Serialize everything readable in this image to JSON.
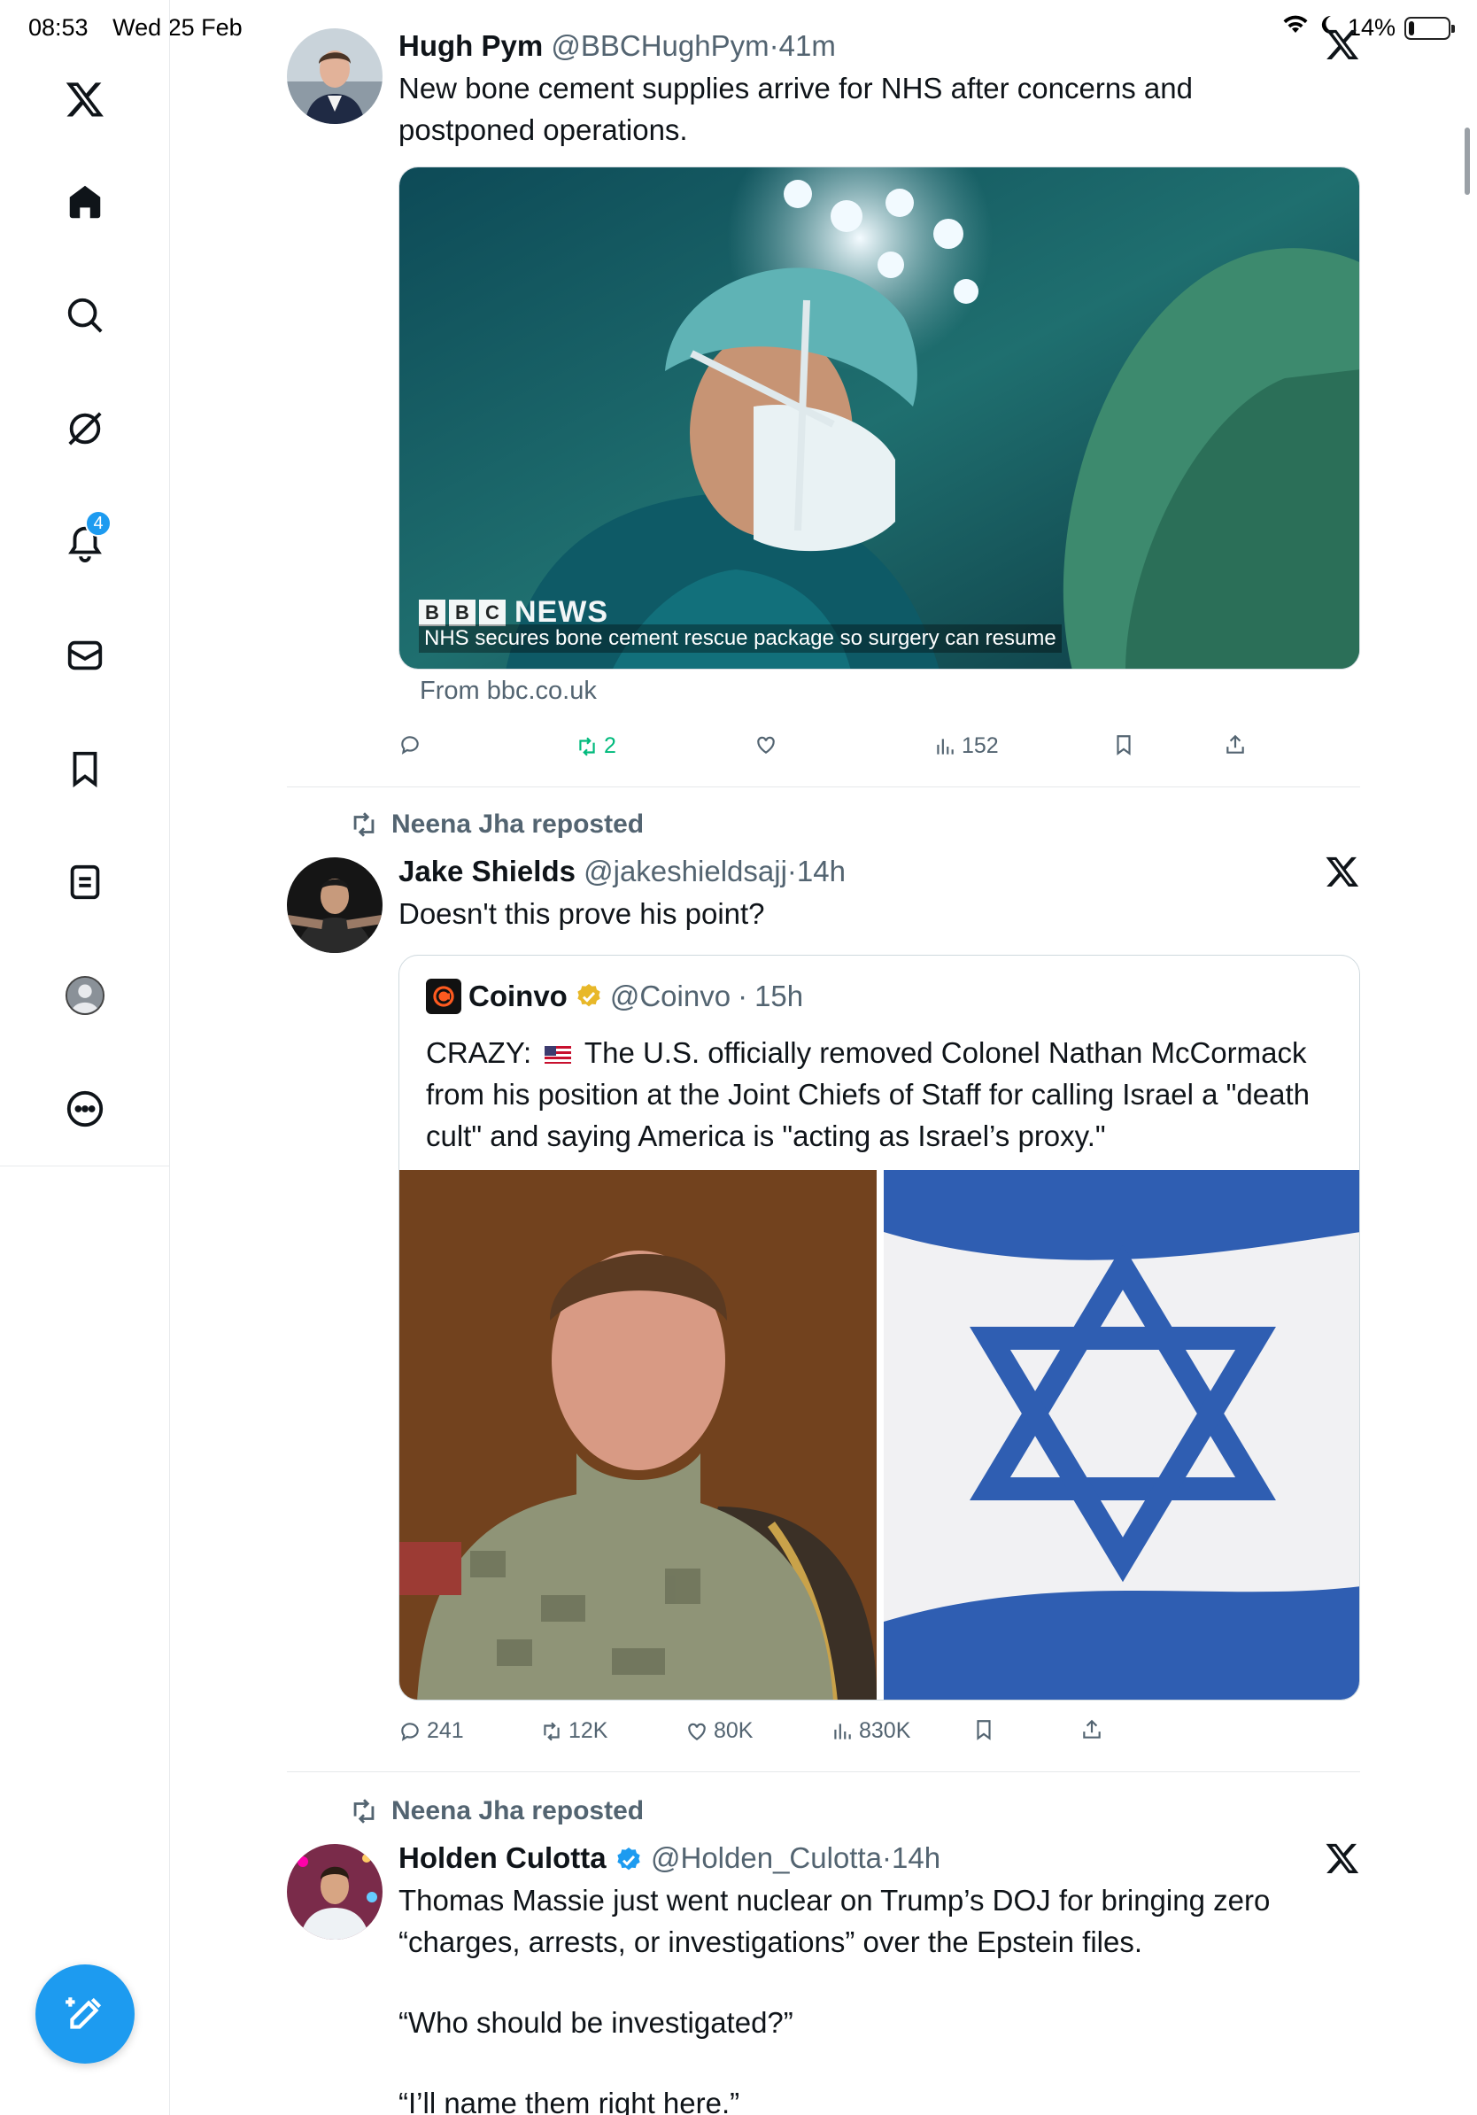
{
  "status": {
    "time": "08:53",
    "date": "Wed 25 Feb",
    "battery": "14%",
    "battery_level": 0.14
  },
  "sidebar": {
    "items": [
      {
        "name": "x-logo"
      },
      {
        "name": "home"
      },
      {
        "name": "explore"
      },
      {
        "name": "grok"
      },
      {
        "name": "notifications",
        "badge": "4"
      },
      {
        "name": "messages"
      },
      {
        "name": "bookmarks"
      },
      {
        "name": "lists"
      },
      {
        "name": "profile"
      },
      {
        "name": "more"
      }
    ],
    "accent": "#1d9bf0"
  },
  "tweets": [
    {
      "name": "Hugh Pym",
      "handle": "@BBCHughPym",
      "time": "41m",
      "text": "New bone cement supplies arrive for NHS after concerns and postponed operations.",
      "card": {
        "logo_text": "NEWS",
        "logo_letters": [
          "B",
          "B",
          "C"
        ],
        "caption": "NHS secures bone cement rescue package so surgery can resume",
        "from": "From bbc.co.uk"
      },
      "actions": {
        "reply": "",
        "repost": "2",
        "like": "",
        "views": "152"
      }
    },
    {
      "reposted_by": "Neena Jha reposted",
      "name": "Jake Shields",
      "handle": "@jakeshieldsajj",
      "time": "14h",
      "text": "Doesn't this prove his point?",
      "quote": {
        "name": "Coinvo",
        "handle": "@Coinvo",
        "time": "15h",
        "text_before_flag": "CRAZY: ",
        "text_after_flag": " The U.S. officially removed Colonel Nathan McCormack from his position at the Joint Chiefs of Staff for calling Israel a \"death cult\" and saying America is \"acting as Israel’s proxy.\""
      },
      "actions": {
        "reply": "241",
        "repost": "12K",
        "like": "80K",
        "views": "830K"
      }
    },
    {
      "reposted_by": "Neena Jha reposted",
      "name": "Holden Culotta",
      "handle": "@Holden_Culotta",
      "time": "14h",
      "text_lines": [
        "Thomas Massie just went nuclear on Trump’s DOJ for bringing zero “charges, arrests, or investigations” over the Epstein files.",
        "“Who should be investigated?”",
        "“I’ll name them right here.”"
      ]
    }
  ],
  "separator": "·"
}
